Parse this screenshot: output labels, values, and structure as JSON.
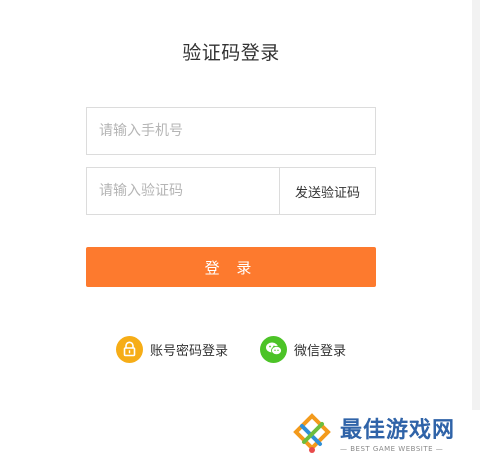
{
  "page": {
    "title": "验证码登录"
  },
  "form": {
    "phone_placeholder": "请输入手机号",
    "code_placeholder": "请输入验证码",
    "send_code_label": "发送验证码",
    "login_label": "登 录"
  },
  "alternatives": {
    "account_login_label": "账号密码登录",
    "account_icon": "lock-icon",
    "wechat_login_label": "微信登录",
    "wechat_icon": "wechat-icon"
  },
  "watermark": {
    "main": "最佳游戏网",
    "sub": "— BEST GAME WEBSITE —"
  },
  "colors": {
    "accent": "#fd7a2e",
    "lock_icon_bg": "#f6ad17",
    "wechat_icon_bg": "#4cc327"
  }
}
